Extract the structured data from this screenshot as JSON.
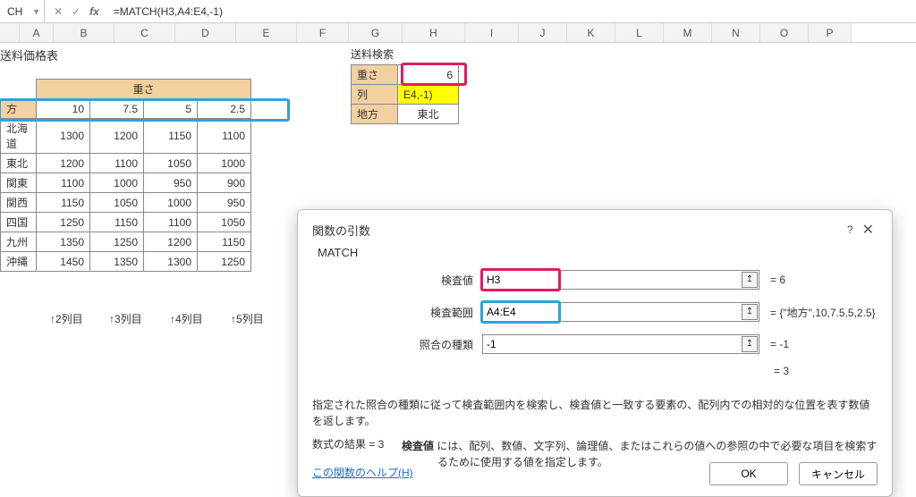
{
  "formula_bar": {
    "name_box": "CH",
    "cancel": "✕",
    "confirm": "✓",
    "fx": "fx",
    "formula": "=MATCH(H3,A4:E4,-1)"
  },
  "columns": [
    "A",
    "B",
    "C",
    "D",
    "E",
    "F",
    "G",
    "H",
    "I",
    "J",
    "K",
    "L",
    "M",
    "N",
    "O",
    "P"
  ],
  "sheet": {
    "title": "送料価格表",
    "weight_header": "重さ",
    "region_header": "方",
    "weights": [
      "10",
      "7.5",
      "5",
      "2.5"
    ],
    "rows": [
      {
        "region": "北海道",
        "v": [
          "1300",
          "1200",
          "1150",
          "1100"
        ]
      },
      {
        "region": "東北",
        "v": [
          "1200",
          "1100",
          "1050",
          "1000"
        ]
      },
      {
        "region": "関東",
        "v": [
          "1100",
          "1000",
          "950",
          "900"
        ]
      },
      {
        "region": "関西",
        "v": [
          "1150",
          "1050",
          "1000",
          "950"
        ]
      },
      {
        "region": "四国",
        "v": [
          "1250",
          "1150",
          "1100",
          "1050"
        ]
      },
      {
        "region": "九州",
        "v": [
          "1350",
          "1250",
          "1200",
          "1150"
        ]
      },
      {
        "region": "沖縄",
        "v": [
          "1450",
          "1350",
          "1300",
          "1250"
        ]
      }
    ],
    "hints": [
      "↑2列目",
      "↑3列目",
      "↑4列目",
      "↑5列目"
    ]
  },
  "search": {
    "title": "送料検索",
    "rows": [
      {
        "label": "重さ",
        "value": "6",
        "yellow": false
      },
      {
        "label": "列",
        "value": "E4,-1)",
        "yellow": true,
        "left": true
      },
      {
        "label": "地方",
        "value": "東北",
        "yellow": false
      }
    ]
  },
  "dialog": {
    "title": "関数の引数",
    "function": "MATCH",
    "args": [
      {
        "label": "検査値",
        "value": "H3",
        "result": "=  6",
        "box": "pink"
      },
      {
        "label": "検査範囲",
        "value": "A4:E4",
        "result": "=  {\"地方\",10,7.5,5,2.5}",
        "box": "blue"
      },
      {
        "label": "照合の種類",
        "value": "-1",
        "result": "=  -1",
        "box": ""
      }
    ],
    "mid_result": "=  3",
    "desc1": "指定された照合の種類に従って検査範囲内を検索し、検査値と一致する要素の、配列内での相対的な位置を表す数値を返します。",
    "desc2_label": "検査値",
    "desc2": "には、配列、数値、文字列、論理値、またはこれらの値への参照の中で必要な項目を検索するために使用する値を指定します。",
    "formula_result": "数式の結果 =  3",
    "help": "この関数のヘルプ(H)",
    "ok": "OK",
    "cancel": "キャンセル"
  }
}
